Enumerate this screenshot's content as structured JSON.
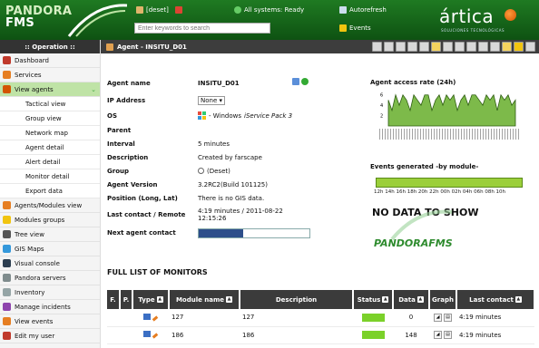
{
  "header": {
    "logo_line1": "PANDORA",
    "logo_line2": "FMS",
    "user": "[deset]",
    "system_status": "All systems: Ready",
    "autorefresh": "Autorefresh",
    "search_placeholder": "Enter keywords to search",
    "events": "Events",
    "brand": "ártica",
    "brand_sub": "SOLUCIONES TECNOLÓGICAS"
  },
  "sidebar": {
    "title": ":: Operation ::",
    "items": [
      {
        "label": "Dashboard",
        "color": "#c0392b"
      },
      {
        "label": "Services",
        "color": "#e67e22"
      },
      {
        "label": "View agents",
        "color": "#d35400",
        "active": true
      },
      {
        "label": "Tactical view",
        "sub": true
      },
      {
        "label": "Group view",
        "sub": true
      },
      {
        "label": "Network map",
        "sub": true
      },
      {
        "label": "Agent detail",
        "sub": true
      },
      {
        "label": "Alert detail",
        "sub": true
      },
      {
        "label": "Monitor detail",
        "sub": true
      },
      {
        "label": "Export data",
        "sub": true
      },
      {
        "label": "Agents/Modules view",
        "color": "#e67e22"
      },
      {
        "label": "Modules groups",
        "color": "#f1c40f"
      },
      {
        "label": "Tree view",
        "color": "#555555"
      },
      {
        "label": "GIS Maps",
        "color": "#3498db"
      },
      {
        "label": "Visual console",
        "color": "#2c3e50"
      },
      {
        "label": "Pandora servers",
        "color": "#7f8c8d"
      },
      {
        "label": "Inventory",
        "color": "#95a5a6"
      },
      {
        "label": "Manage incidents",
        "color": "#8e44ad"
      },
      {
        "label": "View events",
        "color": "#e67e22"
      },
      {
        "label": "Edit my user",
        "color": "#c0392b"
      }
    ]
  },
  "titlebar": {
    "title": "Agent - INSITU_D01"
  },
  "agent": {
    "name_label": "Agent name",
    "name": "INSITU_D01",
    "ip_label": "IP Address",
    "ip": "None",
    "os_label": "OS",
    "os": "- Windows ",
    "os_sp": "iService Pack 3",
    "parent_label": "Parent",
    "parent": "",
    "interval_label": "Interval",
    "interval": "5 minutes",
    "description_label": "Description",
    "description": "Created by farscape",
    "group_label": "Group",
    "group": "(Deset)",
    "version_label": "Agent Version",
    "version": "3.2RC2(Build 101125)",
    "position_label": "Position (Long, Lat)",
    "position": "There is no GIS data.",
    "last_contact_label": "Last contact / Remote",
    "last_contact": "4:19 minutes / 2011-08-22 12:15:26",
    "next_contact_label": "Next agent contact",
    "next_contact_progress": 0.4
  },
  "right": {
    "access_title": "Agent access rate (24h)",
    "access_yticks": [
      "6",
      "4",
      "2"
    ],
    "access_values": [
      5,
      3,
      6,
      4,
      6,
      5,
      3,
      6,
      5,
      4,
      6,
      6,
      3,
      5,
      6,
      4,
      6,
      5,
      6,
      3,
      5,
      6,
      4,
      6,
      6,
      5,
      4,
      6,
      5,
      6,
      3,
      6,
      5,
      6,
      4,
      5
    ],
    "events_title": "Events generated -by module-",
    "events_hours": "12h 14h 16h 18h 20h 22h 00h 02h 04h 06h 08h 10h",
    "nodata": "NO DATA TO SHOW",
    "nodata_logo": "PANDORAFMS"
  },
  "monitors": {
    "title": "FULL LIST OF MONITORS",
    "headers": {
      "f": "F.",
      "p": "P.",
      "type": "Type",
      "module_name": "Module name",
      "description": "Description",
      "status": "Status",
      "data": "Data",
      "graph": "Graph",
      "last_contact": "Last contact"
    },
    "rows": [
      {
        "module_name": "127",
        "description": "127",
        "data": "0",
        "last_contact": "4:19 minutes"
      },
      {
        "module_name": "186",
        "description": "186",
        "data": "148",
        "last_contact": "4:19 minutes"
      }
    ]
  }
}
